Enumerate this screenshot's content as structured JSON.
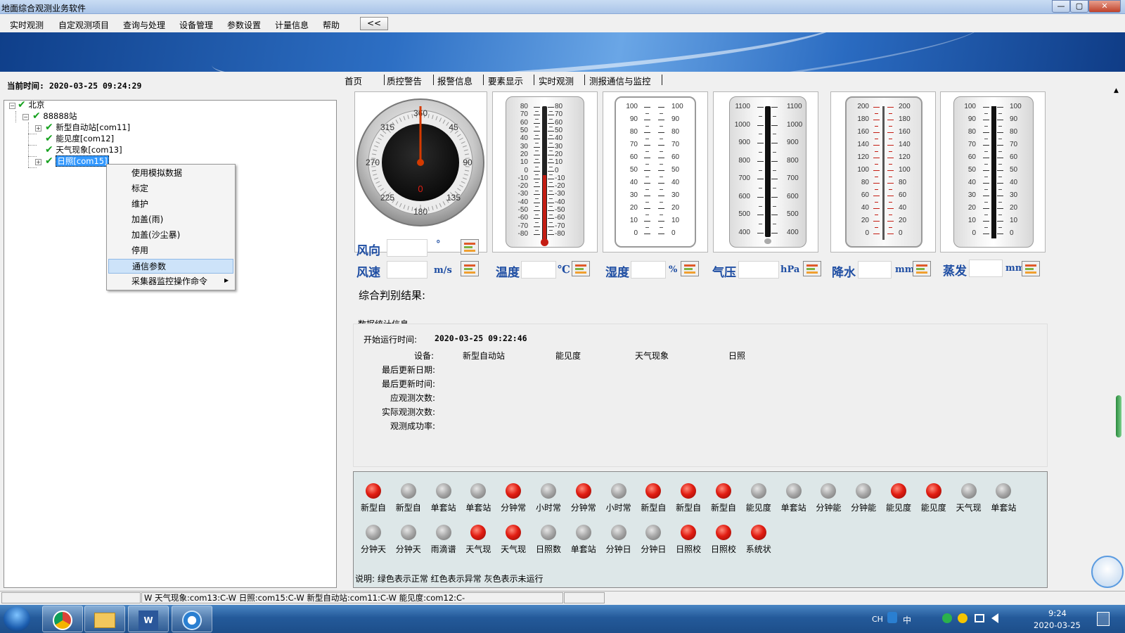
{
  "window": {
    "title": "地面综合观测业务软件",
    "controls": [
      "—",
      "▢",
      "✕"
    ]
  },
  "menu": [
    "实时观测",
    "自定观测项目",
    "查询与处理",
    "设备管理",
    "参数设置",
    "计量信息",
    "帮助"
  ],
  "collapse_label": "<<",
  "current_time": "当前时间:  2020-03-25 09:24:29",
  "tree": {
    "root": "北京",
    "station": "88888站",
    "devices": [
      "新型自动站[com11]",
      "能见度[com12]",
      "天气现象[com13]",
      "日照[com15]"
    ]
  },
  "context_menu": {
    "items": [
      "使用模拟数据",
      "标定",
      "维护",
      "加盖(雨)",
      "加盖(沙尘暴)",
      "停用",
      "通信参数",
      "采集器监控操作命令"
    ],
    "selected": "通信参数",
    "submenu_arrow": "▶"
  },
  "tabs": [
    "首页",
    "质控警告",
    "报警信息",
    "要素显示",
    "实时观测",
    "测报通信与监控"
  ],
  "compass": {
    "labels": [
      "360",
      "45",
      "90",
      "135",
      "180",
      "225",
      "270",
      "315"
    ],
    "center": "0"
  },
  "temp_scale": [
    "80",
    "70",
    "60",
    "50",
    "40",
    "30",
    "20",
    "10",
    "0",
    "-10",
    "-20",
    "-30",
    "-40",
    "-50",
    "-60",
    "-70",
    "-80"
  ],
  "humid_scale": [
    "100",
    "90",
    "80",
    "70",
    "60",
    "50",
    "40",
    "30",
    "20",
    "10",
    "0"
  ],
  "press_scale": [
    "1100",
    "1000",
    "900",
    "800",
    "700",
    "600",
    "500",
    "400"
  ],
  "rain_scale": [
    "200",
    "180",
    "160",
    "140",
    "120",
    "100",
    "80",
    "60",
    "40",
    "20",
    "0"
  ],
  "evap_scale": [
    "100",
    "90",
    "80",
    "70",
    "60",
    "50",
    "40",
    "30",
    "20",
    "10",
    "0"
  ],
  "readouts": {
    "wind_dir": {
      "label": "风向",
      "unit": "°",
      "value": ""
    },
    "wind_speed": {
      "label": "风速",
      "unit": "m/s",
      "value": ""
    },
    "temp": {
      "label": "温度",
      "unit": "℃",
      "value": ""
    },
    "humid": {
      "label": "湿度",
      "unit": "%",
      "value": ""
    },
    "press": {
      "label": "气压",
      "unit": "hPa",
      "value": ""
    },
    "rain": {
      "label": "降水",
      "unit": "mm",
      "value": ""
    },
    "evap": {
      "label": "蒸发",
      "unit": "mm",
      "value": ""
    }
  },
  "judge_label": "综合判别结果:",
  "stats": {
    "title": "数据统计信息",
    "start_label": "开始运行时间:",
    "start_value": "2020-03-25  09:22:46",
    "device_label": "设备:",
    "devices": [
      "新型自动站",
      "能见度",
      "天气现象",
      "日照"
    ],
    "rows": [
      "最后更新日期:",
      "最后更新时间:",
      "应观测次数:",
      "实际观测次数:",
      "观测成功率:"
    ]
  },
  "lamps": [
    {
      "label": "新型自",
      "state": "red"
    },
    {
      "label": "新型自",
      "state": "gray"
    },
    {
      "label": "单套站",
      "state": "gray"
    },
    {
      "label": "单套站",
      "state": "gray"
    },
    {
      "label": "分钟常",
      "state": "red"
    },
    {
      "label": "小时常",
      "state": "gray"
    },
    {
      "label": "分钟常",
      "state": "red"
    },
    {
      "label": "小时常",
      "state": "gray"
    },
    {
      "label": "新型自",
      "state": "red"
    },
    {
      "label": "新型自",
      "state": "red"
    },
    {
      "label": "新型自",
      "state": "red"
    },
    {
      "label": "能见度",
      "state": "gray"
    },
    {
      "label": "单套站",
      "state": "gray"
    },
    {
      "label": "分钟能",
      "state": "gray"
    },
    {
      "label": "分钟能",
      "state": "gray"
    },
    {
      "label": "能见度",
      "state": "red"
    },
    {
      "label": "能见度",
      "state": "red"
    },
    {
      "label": "天气现",
      "state": "gray"
    },
    {
      "label": "单套站",
      "state": "gray"
    },
    {
      "label": "分钟天",
      "state": "gray"
    },
    {
      "label": "分钟天",
      "state": "gray"
    },
    {
      "label": "雨滴谱",
      "state": "gray"
    },
    {
      "label": "天气现",
      "state": "red"
    },
    {
      "label": "天气现",
      "state": "red"
    },
    {
      "label": "日照数",
      "state": "gray"
    },
    {
      "label": "单套站",
      "state": "gray"
    },
    {
      "label": "分钟日",
      "state": "gray"
    },
    {
      "label": "分钟日",
      "state": "gray"
    },
    {
      "label": "日照校",
      "state": "red"
    },
    {
      "label": "日照校",
      "state": "red"
    },
    {
      "label": "系统状",
      "state": "red"
    }
  ],
  "legend_note": "说明: 绿色表示正常  红色表示异常  灰色表示未运行",
  "statusbar": {
    "text": "W  天气现象:com13:C-W  日照:com15:C-W  新型自动站:com11:C-W  能见度:com12:C-"
  },
  "taskbar": {
    "lang": "CH",
    "time": "9:24",
    "date": "2020-03-25",
    "ime": "中"
  },
  "colors": {
    "red_lamp": "#e11d12",
    "gray_lamp": "#a9a9a9",
    "label_blue": "#1f4ea3",
    "check_green": "#15a11e"
  }
}
